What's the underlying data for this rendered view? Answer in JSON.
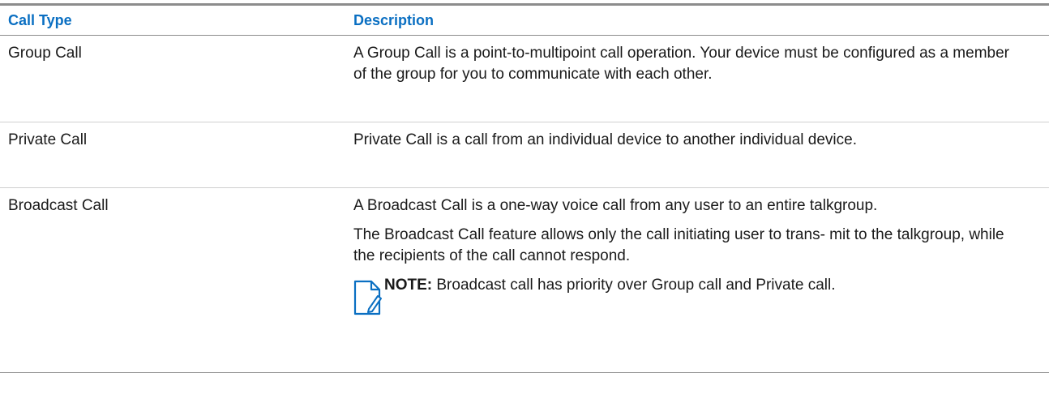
{
  "table": {
    "header": {
      "col1": "Call Type",
      "col2": "Description"
    },
    "rows": [
      {
        "type": "Group Call",
        "desc": "A Group Call is a point-to-multipoint call operation. Your device must be configured as a member of the group for you to communicate with each other."
      },
      {
        "type": "Private Call",
        "desc": "Private Call is a call from an individual device to another individual device."
      },
      {
        "type": "Broadcast Call",
        "desc": "A Broadcast Call is a one-way voice call from any user to an entire talkgroup.",
        "desc2": "The Broadcast Call feature allows only the call initiating user to trans- mit to the talkgroup, while the recipients of the call cannot respond.",
        "note_label": "NOTE:",
        "note_text": " Broadcast call has priority over Group call and Private call."
      }
    ]
  },
  "colors": {
    "header_text": "#0a6fc2",
    "rule": "#8c8c8c",
    "icon": "#0a6fc2"
  },
  "icons": {
    "note": "note-icon"
  }
}
